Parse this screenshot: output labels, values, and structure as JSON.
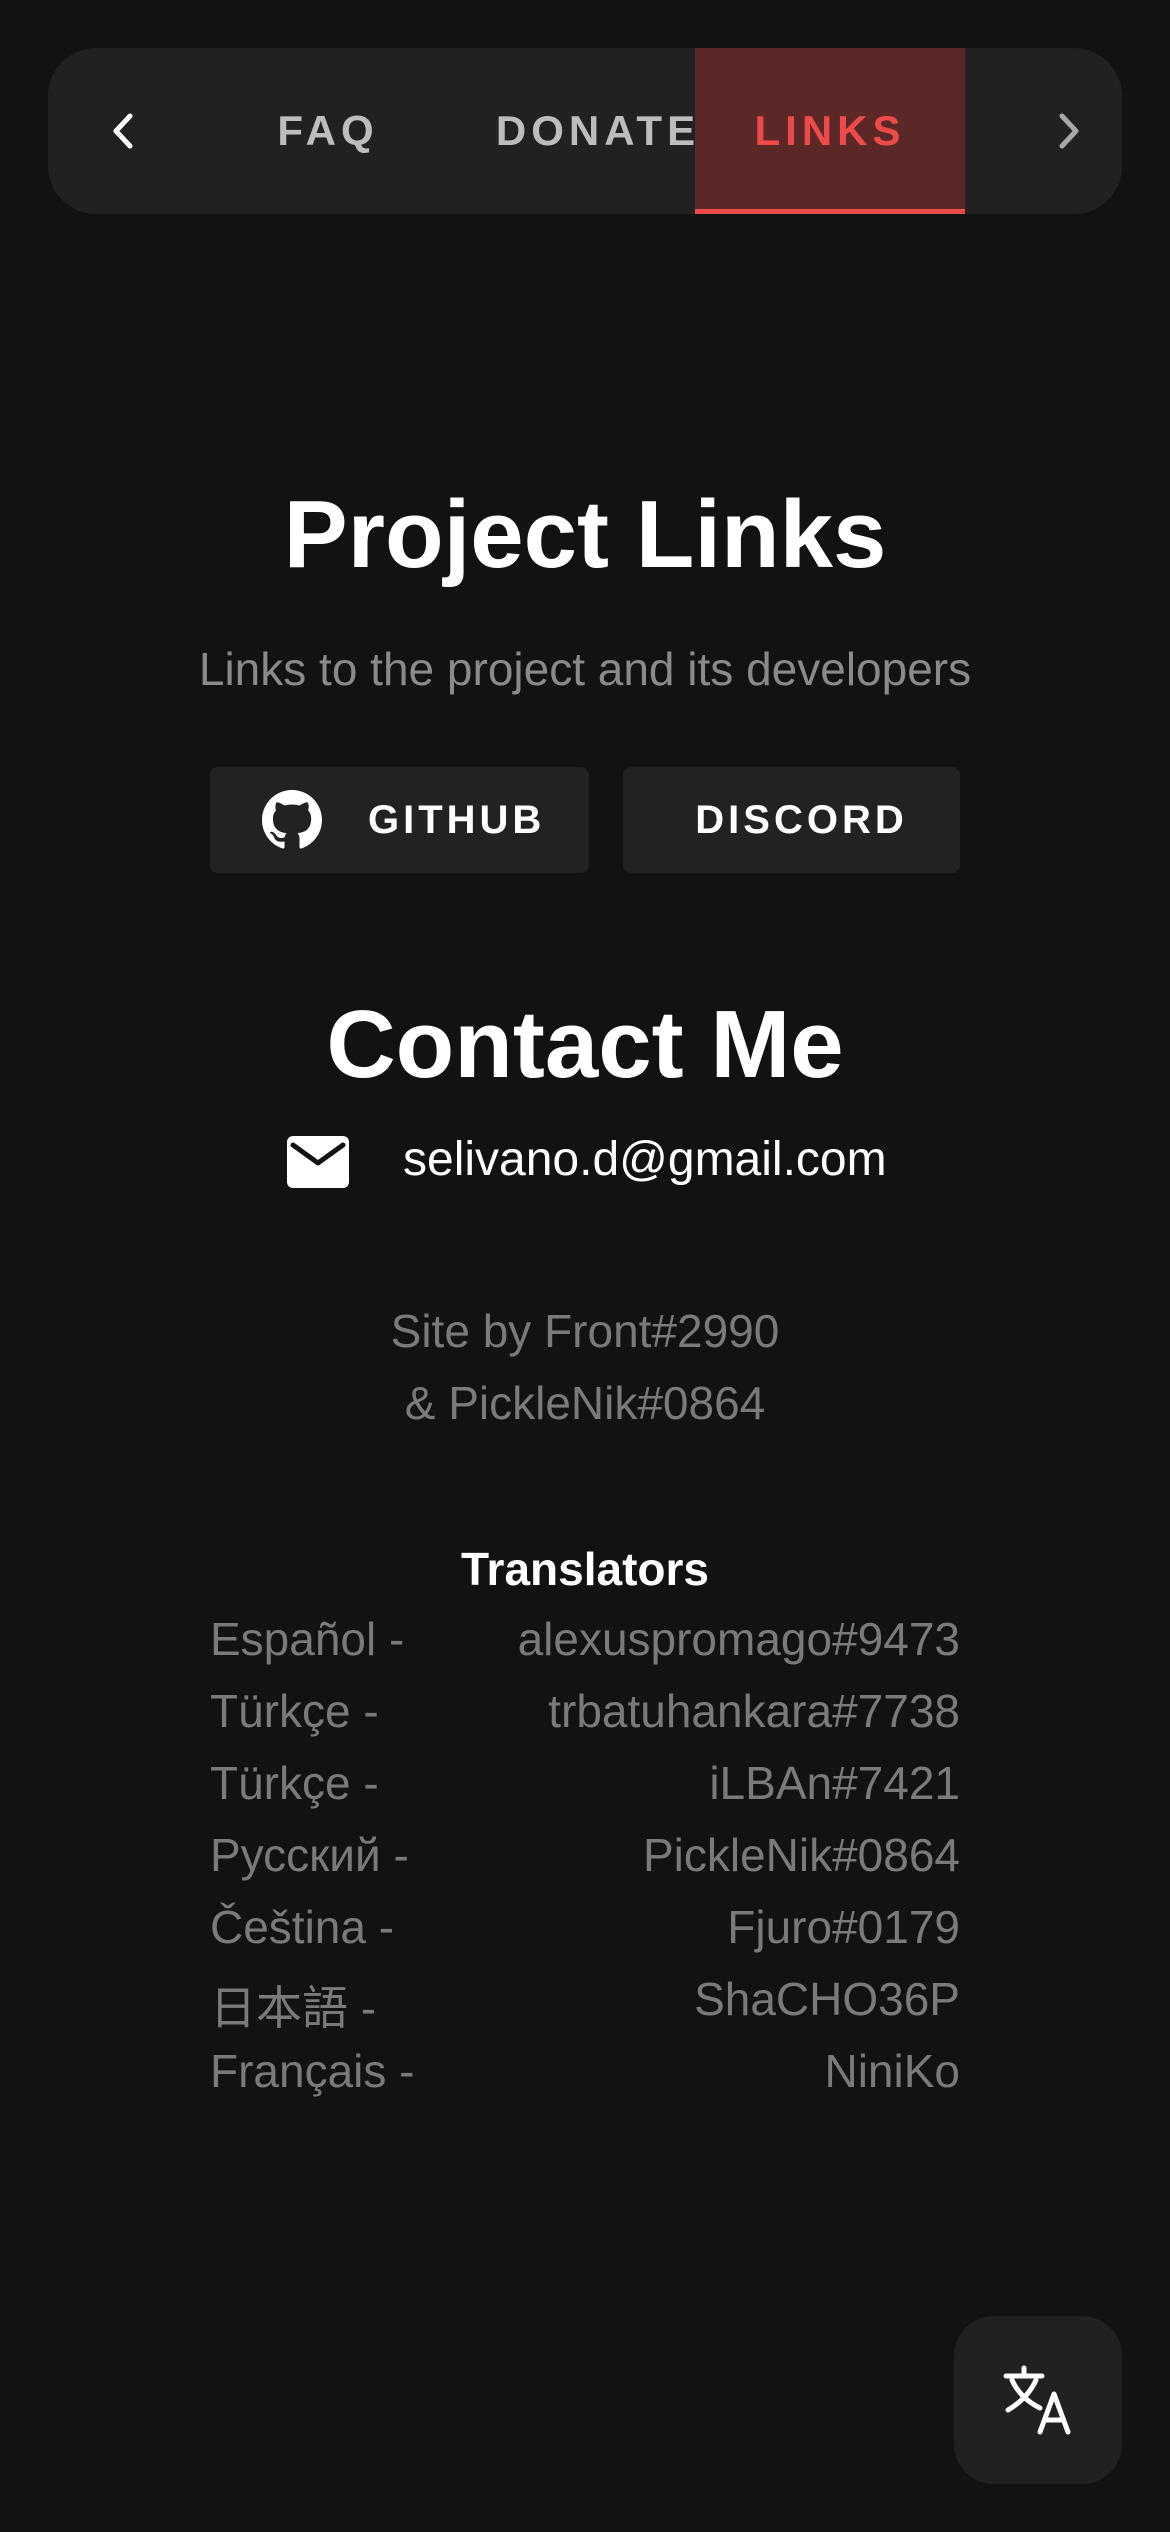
{
  "tabs": {
    "prev_icon": "chevron-left-icon",
    "next_icon": "chevron-right-icon",
    "items": [
      {
        "label": "FAQ"
      },
      {
        "label": "DONATE"
      },
      {
        "label": "LINKS",
        "active": true
      }
    ]
  },
  "project": {
    "title": "Project Links",
    "subtitle": "Links to the project and its developers",
    "github_label": "GITHUB",
    "discord_label": "DISCORD"
  },
  "contact": {
    "title": "Contact Me",
    "email": "selivano.d@gmail.com"
  },
  "credits": {
    "line1": "Site by  Front#2990",
    "line2": "&  PickleNik#0864"
  },
  "translators": {
    "title": "Translators",
    "items": [
      {
        "language": "Español -",
        "name": "alexuspromago#9473"
      },
      {
        "language": "Türkçe -",
        "name": "trbatuhankara#7738"
      },
      {
        "language": "Türkçe -",
        "name": "iLBAn#7421"
      },
      {
        "language": "Русский -",
        "name": "PickleNik#0864"
      },
      {
        "language": "Čeština -",
        "name": "Fjuro#0179"
      },
      {
        "language": "日本語 -",
        "name": "ShaCHO36P"
      },
      {
        "language": "Français -",
        "name": "NiniKo"
      }
    ]
  },
  "fab": {
    "icon": "translate-icon"
  },
  "colors": {
    "background": "#121212",
    "surface": "#212121",
    "accent": "#ef4a4a",
    "active_tab_bg": "#5c2727"
  }
}
